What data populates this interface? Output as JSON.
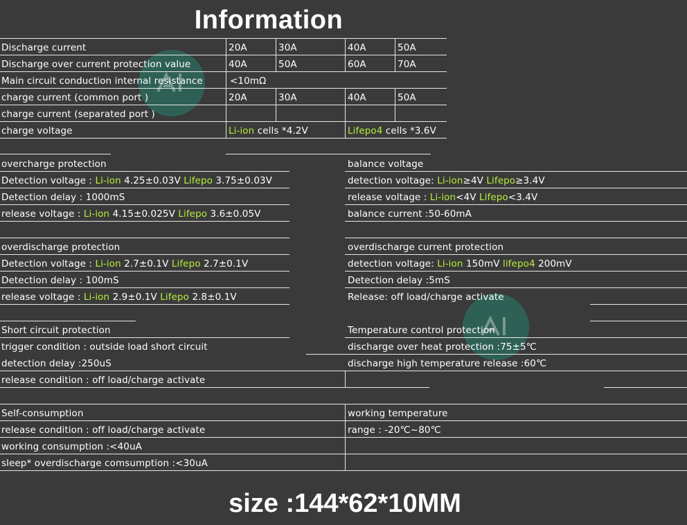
{
  "title": "Information",
  "footer": "size :144*62*10MM",
  "top_table": {
    "discharge_current": {
      "label": "Discharge current",
      "values": [
        "20A",
        "30A",
        "40A",
        "50A"
      ]
    },
    "over_current": {
      "label": "Discharge over current protection  value",
      "values": [
        "40A",
        "50A",
        "60A",
        "70A"
      ]
    },
    "resistance": {
      "label": "Main circuit conduction internal resistance",
      "value": "<10mΩ"
    },
    "charge_common": {
      "label": "charge current (common port )",
      "values": [
        "20A",
        "30A",
        "40A",
        "50A"
      ]
    },
    "charge_separated": {
      "label": "charge current (separated port )"
    },
    "charge_voltage": {
      "label": "charge voltage",
      "liion": "Li-ion",
      "liion_value": " cells *4.2V",
      "lifepo": "Lifepo4",
      "lifepo_value": " cells *3.6V"
    }
  },
  "overcharge": {
    "header": "overcharge protection",
    "detection_prefix": "Detection voltage : ",
    "detection_liion": "Li-ion",
    "detection_liion_value": " 4.25±0.03V ",
    "detection_lifepo": "Lifepo",
    "detection_lifepo_value": " 3.75±0.03V",
    "delay": "Detection delay : 1000mS",
    "release_prefix": "release voltage : ",
    "release_liion": "Li-ion",
    "release_liion_value": " 4.15±0.025V ",
    "release_lifepo": "Lifepo",
    "release_lifepo_value": " 3.6±0.05V"
  },
  "balance": {
    "header": "balance voltage",
    "detection_prefix": "detection voltage: ",
    "detection_liion": "Li-ion",
    "detection_liion_value": "≥4V ",
    "detection_lifepo": "Lifepo",
    "detection_lifepo_value": "≥3.4V",
    "release_prefix": "release voltage : ",
    "release_liion": "Li-ion",
    "release_liion_value": "<4V ",
    "release_lifepo": "Lifepo",
    "release_lifepo_value": "<3.4V",
    "current": "balance current :50-60mA"
  },
  "overdischarge": {
    "header": "overdischarge protection",
    "detection_prefix": "Detection voltage : ",
    "detection_liion": "Li-ion",
    "detection_liion_value": " 2.7±0.1V ",
    "detection_lifepo": "Lifepo",
    "detection_lifepo_value": " 2.7±0.1V",
    "delay": "Detection delay : 100mS",
    "release_prefix": "release voltage : ",
    "release_liion": "Li-ion",
    "release_liion_value": " 2.9±0.1V ",
    "release_lifepo": "Lifepo",
    "release_lifepo_value": " 2.8±0.1V"
  },
  "overdischarge_current": {
    "header": "overdischarge current protection",
    "detection_prefix": "detection voltage: ",
    "detection_liion": "Li-ion",
    "detection_liion_value": " 150mV ",
    "detection_lifepo": "lifepo4",
    "detection_lifepo_value": " 200mV",
    "delay": "Detection delay :5mS",
    "release": "Release: off load/charge activate"
  },
  "short_circuit": {
    "header": "Short circuit protection",
    "trigger": "trigger condition : outside load short circuit",
    "delay": "detection delay :250uS",
    "release": "release condition : off load/charge activate"
  },
  "temperature": {
    "header": "Temperature control protection",
    "over_heat": "discharge over heat protection :75±5℃",
    "release": "discharge high temperature release :60℃"
  },
  "self_consumption": {
    "header": "Self-consumption",
    "release": "release condition : off load/charge activate",
    "working": "working consumption :<40uA",
    "sleep": "sleep* overdischarge comsumption :<30uA"
  },
  "working_temperature": {
    "header": "working  temperature",
    "range": "range : -20℃~80℃"
  },
  "colors": {
    "background": "#3a3a3a",
    "text": "#ffffff",
    "highlight": "#b7f03a"
  }
}
